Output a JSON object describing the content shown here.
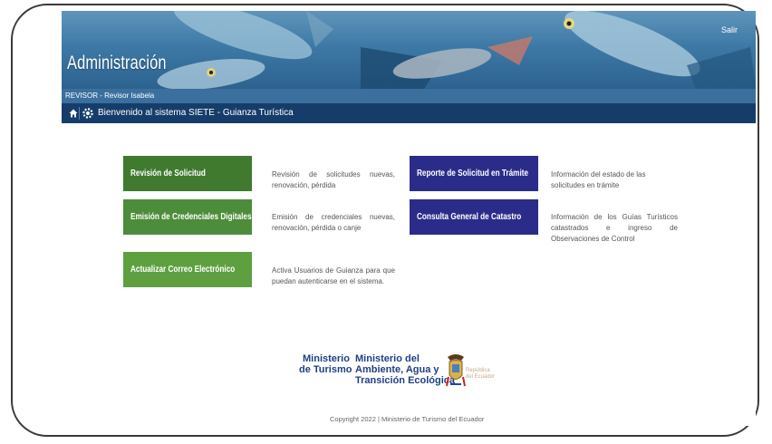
{
  "header": {
    "title": "Administración",
    "logout_label": "Salir",
    "role_text": "REVISOR - Revisor Isabela",
    "welcome_text": "Bienvenido al sistema SIETE - Guianza Turística"
  },
  "icons": {
    "home": "home-icon",
    "settings": "gear-icon"
  },
  "actions": {
    "left": [
      {
        "label": "Revisión de Solicitud",
        "description": "Revisión de solicitudes nuevas, renovación, pérdida",
        "color": "#3f7a2f"
      },
      {
        "label": "Emisión de Credenciales Digitales",
        "description": "Emisión de credenciales nuevas, renovación, pérdida o canje",
        "color": "#4d8c3a"
      },
      {
        "label": "Actualizar Correo Electrónico",
        "description": "Activa Usuarios de Guianza para que puedan autenticarse en el sistema.",
        "color": "#5ea040"
      }
    ],
    "right": [
      {
        "label": "Reporte de Solicitud en Trámite",
        "description": "Información del estado de las solicitudes en trámite",
        "color": "#2b2c8a"
      },
      {
        "label": "Consulta General de Catastro",
        "description": "Información de los Guías Turísticos catastrados e ingreso de Observaciones de Control",
        "color": "#2b2c8a"
      }
    ]
  },
  "footer": {
    "ministerio_turismo_line1": "Ministerio",
    "ministerio_turismo_line2": "de Turismo",
    "ministerio_ambiente_line1": "Ministerio del",
    "ministerio_ambiente_line2": "Ambiente, Agua y",
    "ministerio_ambiente_line3": "Transición Ecológica",
    "republica_line1": "República",
    "republica_line2": "del Ecuador",
    "copyright": "Copyright 2022 | Ministerio de Turismo del Ecuador"
  }
}
